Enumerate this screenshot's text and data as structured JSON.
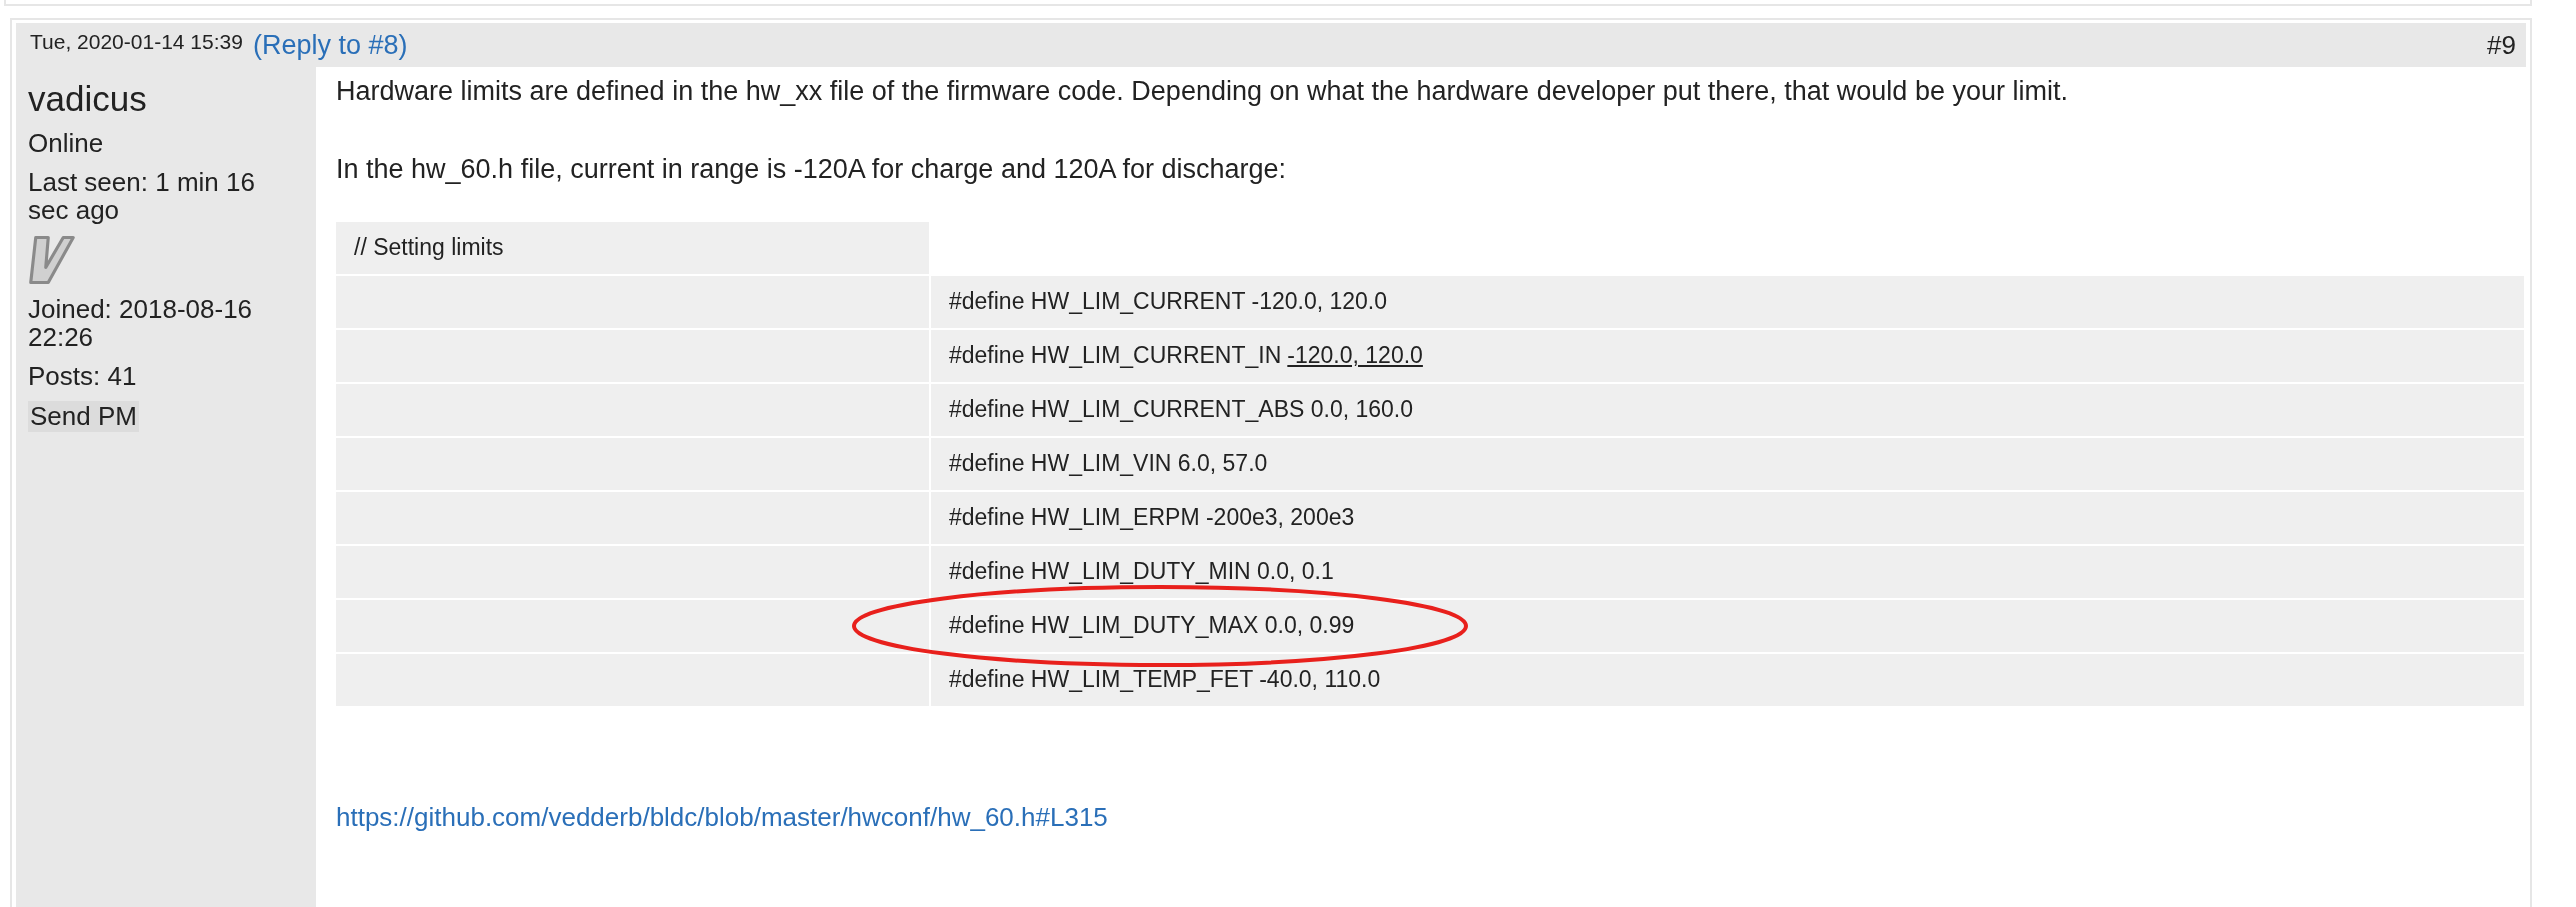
{
  "post": {
    "date": "Tue, 2020-01-14 15:39",
    "reply_link": "(Reply to #8)",
    "number": "#9"
  },
  "author": {
    "name": "vadicus",
    "status": "Online",
    "last_seen": "Last seen: 1 min 16 sec ago",
    "joined": "Joined: 2018-08-16 22:26",
    "posts": "Posts: 41",
    "send_pm": "Send PM"
  },
  "body": {
    "paragraphs": [
      "Hardware limits are defined in the hw_xx file of the firmware code. Depending on what the hardware developer put there, that would be your limit.",
      "In the hw_60.h file, current in range is -120A for charge and 120A for discharge:"
    ],
    "table": {
      "header": "// Setting limits",
      "rows": [
        {
          "text": "#define HW_LIM_CURRENT -120.0, 120.0",
          "circled": false
        },
        {
          "text": "#define HW_LIM_CURRENT_IN",
          "underlined": "-120.0, 120.0",
          "circled": false
        },
        {
          "text": "#define HW_LIM_CURRENT_ABS 0.0, 160.0",
          "circled": false
        },
        {
          "text": "#define HW_LIM_VIN 6.0, 57.0",
          "circled": false
        },
        {
          "text": "#define HW_LIM_ERPM -200e3, 200e3",
          "circled": false
        },
        {
          "text": "#define HW_LIM_DUTY_MIN 0.0, 0.1",
          "circled": false
        },
        {
          "text": "#define HW_LIM_DUTY_MAX 0.0, 0.99",
          "circled": true
        },
        {
          "text": "#define HW_LIM_TEMP_FET -40.0, 110.0",
          "circled": false
        }
      ]
    },
    "link": "https://github.com/vedderb/bldc/blob/master/hwconf/hw_60.h#L315"
  }
}
